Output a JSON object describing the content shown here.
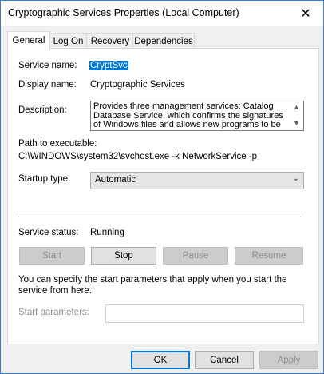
{
  "window": {
    "title": "Cryptographic Services Properties (Local Computer)",
    "close_glyph": "✕"
  },
  "tabs": [
    {
      "label": "General",
      "active": true
    },
    {
      "label": "Log On",
      "active": false
    },
    {
      "label": "Recovery",
      "active": false
    },
    {
      "label": "Dependencies",
      "active": false
    }
  ],
  "general": {
    "service_name_label": "Service name:",
    "service_name_value": "CryptSvc",
    "display_name_label": "Display name:",
    "display_name_value": "Cryptographic Services",
    "description_label": "Description:",
    "description_value": "Provides three management services: Catalog Database Service, which confirms the signatures of Windows files and allows new programs to be",
    "path_label": "Path to executable:",
    "path_value": "C:\\WINDOWS\\system32\\svchost.exe -k NetworkService -p",
    "startup_type_label": "Startup type:",
    "startup_type_value": "Automatic",
    "status_label": "Service status:",
    "status_value": "Running",
    "start_label": "Start",
    "stop_label": "Stop",
    "pause_label": "Pause",
    "resume_label": "Resume",
    "hint_text": "You can specify the start parameters that apply when you start the service from here.",
    "start_params_label": "Start parameters:",
    "start_params_value": ""
  },
  "footer": {
    "ok_label": "OK",
    "cancel_label": "Cancel",
    "apply_label": "Apply"
  },
  "icons": {
    "scroll_up": "▲",
    "scroll_down": "▼",
    "dropdown": "⌄"
  },
  "colors": {
    "selection": "#0078d7",
    "default_button_border": "#0078d7"
  }
}
